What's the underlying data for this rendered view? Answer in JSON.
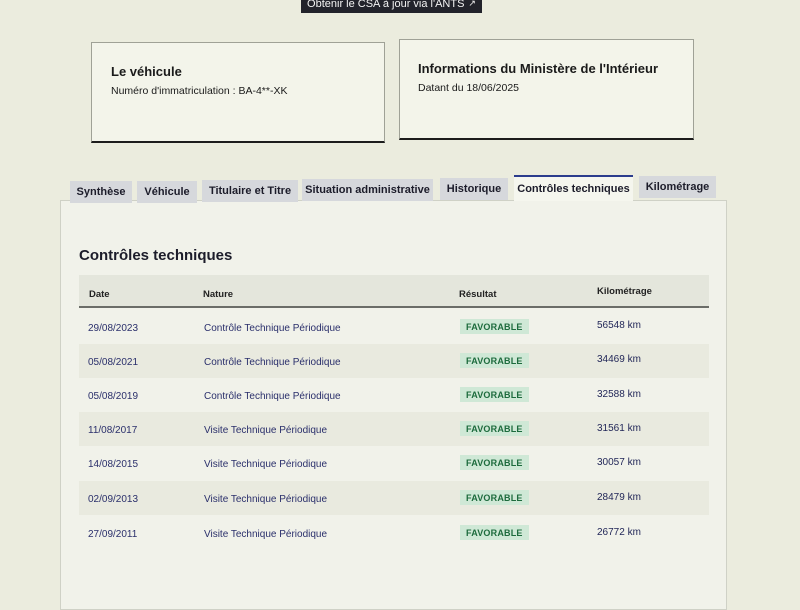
{
  "top_button": {
    "label": "Obtenir le CSA à jour via l'ANTS",
    "icon": "external-link-icon"
  },
  "vehicle_card": {
    "title": "Le véhicule",
    "registration": "Numéro d'immatriculation : BA-4**-XK"
  },
  "ministry_card": {
    "title": "Informations du Ministère de l'Intérieur",
    "date": "Datant du 18/06/2025"
  },
  "tabs": [
    {
      "label": "Synthèse"
    },
    {
      "label": "Véhicule"
    },
    {
      "label": "Titulaire et Titre"
    },
    {
      "label": "Situation administrative"
    },
    {
      "label": "Historique"
    },
    {
      "label": "Contrôles techniques",
      "active": true
    },
    {
      "label": "Kilométrage"
    }
  ],
  "section": {
    "title": "Contrôles techniques",
    "headers": {
      "date": "Date",
      "nature": "Nature",
      "result": "Résultat",
      "mileage": "Kilométrage"
    },
    "rows": [
      {
        "date": "29/08/2023",
        "nature": "Contrôle Technique Périodique",
        "result": "FAVORABLE",
        "mileage": "56548 km"
      },
      {
        "date": "05/08/2021",
        "nature": "Contrôle Technique Périodique",
        "result": "FAVORABLE",
        "mileage": "34469 km"
      },
      {
        "date": "05/08/2019",
        "nature": "Contrôle Technique Périodique",
        "result": "FAVORABLE",
        "mileage": "32588 km"
      },
      {
        "date": "11/08/2017",
        "nature": "Visite Technique Périodique",
        "result": "FAVORABLE",
        "mileage": "31561 km"
      },
      {
        "date": "14/08/2015",
        "nature": "Visite Technique Périodique",
        "result": "FAVORABLE",
        "mileage": "30057 km"
      },
      {
        "date": "02/09/2013",
        "nature": "Visite Technique Périodique",
        "result": "FAVORABLE",
        "mileage": "28479 km"
      },
      {
        "date": "27/09/2011",
        "nature": "Visite Technique Périodique",
        "result": "FAVORABLE",
        "mileage": "26772 km"
      }
    ]
  },
  "colors": {
    "accent": "#2b3c8c",
    "favorable_bg": "#cfe8d6",
    "favorable_text": "#1d6b3d"
  }
}
